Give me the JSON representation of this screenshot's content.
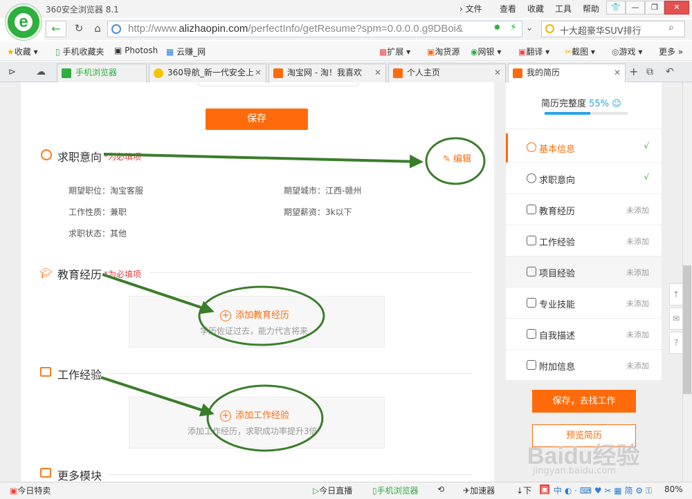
{
  "window": {
    "title": "360安全浏览器 8.1",
    "menu": [
      "文件",
      "查看",
      "收藏",
      "工具",
      "帮助"
    ]
  },
  "address": {
    "url_prefix": "http://www.",
    "url_host": "alizhaopin.com",
    "url_path": "/perfectInfo/getResume?spm=0.0.0.0.g9DBoi&",
    "search_text": "十大超豪华SUV排行"
  },
  "bookmarks": {
    "left": [
      "收藏",
      "手机收藏夹",
      "Photosh",
      "云赚_网"
    ],
    "right": [
      "扩展",
      "淘货源",
      "网银",
      "翻译",
      "截图",
      "游戏",
      "更多"
    ]
  },
  "tabs": [
    {
      "label": "手机浏览器",
      "color": "#2eaf3e"
    },
    {
      "label": "360导航_新一代安全上",
      "color": "#f4c400"
    },
    {
      "label": "淘宝网 - 淘！我喜欢",
      "color": "#ff6b0b"
    },
    {
      "label": "个人主页",
      "color": "#ff6b0b"
    },
    {
      "label": "我的简历",
      "color": "#ff6b0b"
    }
  ],
  "main": {
    "save_label": "保存",
    "job_intent": {
      "title": "求职意向",
      "required": "*为必填项",
      "edit": "编辑",
      "fields": {
        "position": "期望职位：淘宝客服",
        "city": "期望城市：江西-赣州",
        "nature": "工作性质：兼职",
        "salary": "期望薪资：3k以下",
        "status": "求职状态：其他"
      }
    },
    "education": {
      "title": "教育经历",
      "required": "*为必填项",
      "add": "添加教育经历",
      "hint": "学历佐证过去，能力代言将来"
    },
    "work": {
      "title": "工作经验",
      "add": "添加工作经验",
      "hint": "添加工作经历，求职成功率提升3倍"
    },
    "more": {
      "title": "更多模块"
    }
  },
  "sidebar": {
    "completeness_label": "简历完整度",
    "completeness_value": "55%",
    "completeness_fraction": 0.55,
    "items": [
      {
        "label": "基本信息",
        "state": "√"
      },
      {
        "label": "求职意向",
        "state": "√"
      },
      {
        "label": "教育经历",
        "state": "未添加"
      },
      {
        "label": "工作经验",
        "state": "未添加"
      },
      {
        "label": "项目经验",
        "state": "未添加"
      },
      {
        "label": "专业技能",
        "state": "未添加"
      },
      {
        "label": "自我描述",
        "state": "未添加"
      },
      {
        "label": "附加信息",
        "state": "未添加"
      }
    ],
    "go_button": "保存，去找工作",
    "preview_button": "预览简历"
  },
  "statusbar": {
    "left": "今日特卖",
    "live": "今日直播",
    "mobile": "手机浏览器",
    "accel": "加速器",
    "download": "下",
    "zoom": "80%"
  },
  "watermark": {
    "line1": "Baidu经验",
    "line2": "jingyan.baidu.com"
  },
  "colors": {
    "accent": "#ff6b0b",
    "annotation": "#3a7d2a",
    "required": "#e4393c"
  }
}
